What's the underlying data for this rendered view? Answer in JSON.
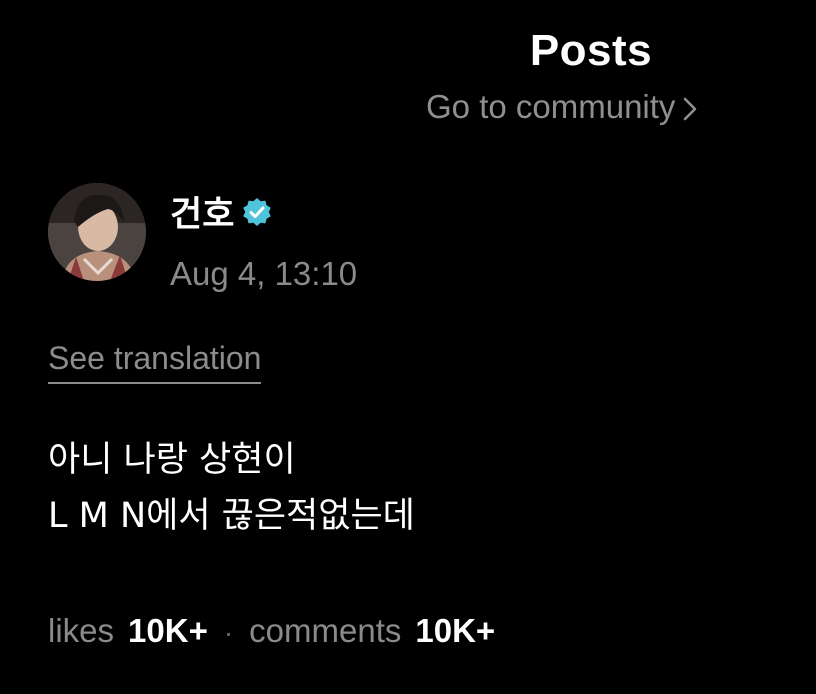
{
  "header": {
    "title": "Posts",
    "community_link": "Go to community"
  },
  "author": {
    "name": "건호",
    "verified": true,
    "timestamp": "Aug 4, 13:10"
  },
  "post": {
    "see_translation": "See translation",
    "lines": [
      "아니 나랑 상현이",
      "L M N에서 끊은적없는데"
    ]
  },
  "stats": {
    "likes_label": "likes",
    "likes_value": "10K+",
    "separator": "·",
    "comments_label": "comments",
    "comments_value": "10K+"
  },
  "colors": {
    "background": "#000000",
    "text_primary": "#ffffff",
    "text_muted": "#8a8a8a",
    "verified_badge": "#4fc3d9"
  },
  "icons": {
    "community_chevron": "chevron-right-icon",
    "verified": "verified-badge-icon"
  }
}
